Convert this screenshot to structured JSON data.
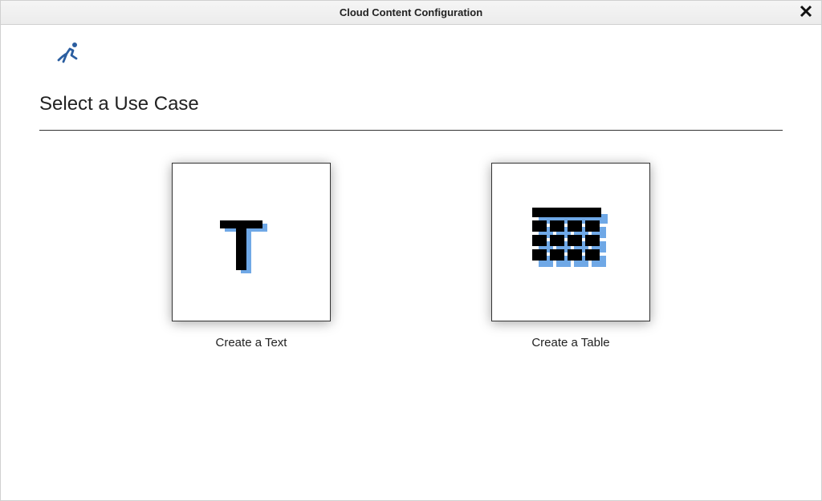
{
  "window": {
    "title": "Cloud Content Configuration"
  },
  "page": {
    "heading": "Select a Use Case"
  },
  "cards": {
    "text": {
      "label": "Create a Text"
    },
    "table": {
      "label": "Create a Table"
    }
  },
  "colors": {
    "accent_blue": "#3a6ea5",
    "icon_blue": "#6fa8e6"
  }
}
